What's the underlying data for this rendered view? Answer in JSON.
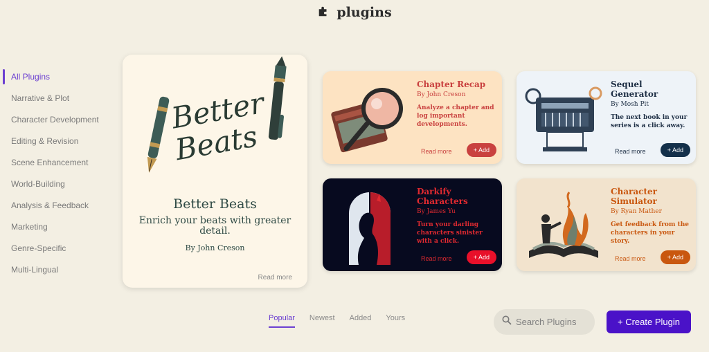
{
  "header": {
    "title": "plugins",
    "icon": "puzzle-icon"
  },
  "sidebar": {
    "items": [
      {
        "label": "All Plugins",
        "active": true
      },
      {
        "label": "Narrative & Plot"
      },
      {
        "label": "Character Development"
      },
      {
        "label": "Editing & Revision"
      },
      {
        "label": "Scene Enhancement"
      },
      {
        "label": "World-Building"
      },
      {
        "label": "Analysis & Feedback"
      },
      {
        "label": "Marketing"
      },
      {
        "label": "Genre-Specific"
      },
      {
        "label": "Multi-Lingual"
      }
    ]
  },
  "featured": {
    "art_text_1": "Better",
    "art_text_2": "Beats",
    "title": "Better Beats",
    "description": "Enrich your beats with greater detail.",
    "author": "By John Creson",
    "read_more": "Read more"
  },
  "cards": [
    {
      "title": "Chapter Recap",
      "author": "By John Creson",
      "description": "Analyze a chapter and log important developments.",
      "read_more": "Read more",
      "add_label": "+ Add",
      "bg": "#fde3c2",
      "title_color": "#c9413f",
      "text_color": "#c9413f",
      "add_color": "#c9413f"
    },
    {
      "title": "Sequel Generator",
      "author": "By Mosh Pit",
      "description": "The next book in your series is a click away.",
      "read_more": "Read more",
      "add_label": "+ Add",
      "bg": "#eef3f8",
      "title_color": "#1e2f45",
      "text_color": "#1e2f45",
      "add_color": "#14304a"
    },
    {
      "title": "Darkify Characters",
      "author": "By James Yu",
      "description": "Turn your darling characters sinister with a click.",
      "read_more": "Read more",
      "add_label": "+ Add",
      "bg": "#070a1f",
      "title_color": "#e02a30",
      "text_color": "#e02a30",
      "add_color": "#e8102a"
    },
    {
      "title": "Character Simulator",
      "author": "By Ryan Mather",
      "description": "Get feedback from the characters in your story.",
      "read_more": "Read more",
      "add_label": "+ Add",
      "bg": "#f2e3cd",
      "title_color": "#c9570f",
      "text_color": "#c9570f",
      "add_color": "#c9570f"
    }
  ],
  "tabs": [
    {
      "label": "Popular",
      "active": true
    },
    {
      "label": "Newest"
    },
    {
      "label": "Added"
    },
    {
      "label": "Yours"
    }
  ],
  "search": {
    "placeholder": "Search Plugins",
    "icon": "search-icon"
  },
  "create_button": {
    "label": "+ Create Plugin"
  }
}
